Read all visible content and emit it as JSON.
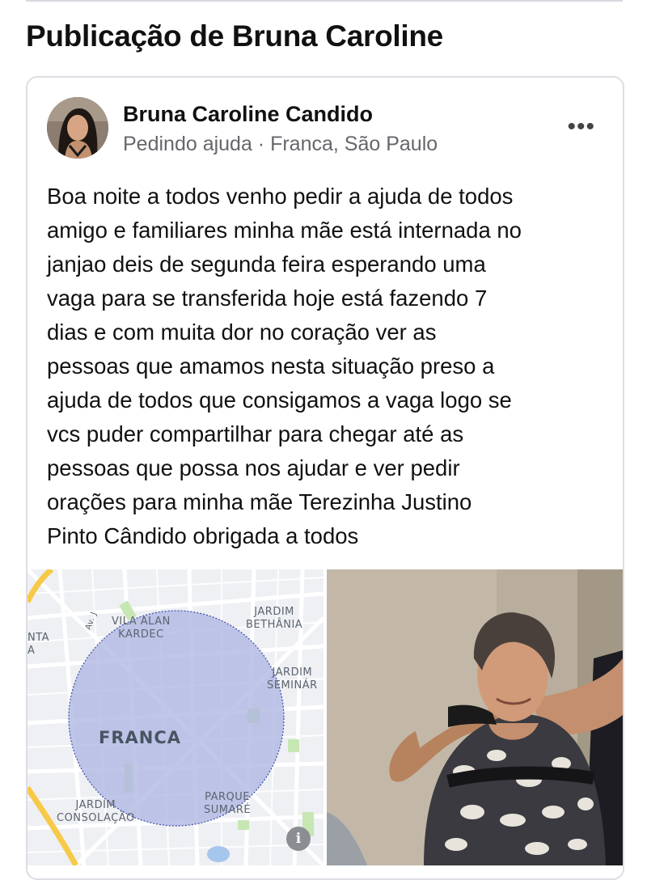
{
  "header": {
    "title": "Publicação de Bruna Caroline"
  },
  "post": {
    "author": "Bruna Caroline Candido",
    "meta": "Pedindo ajuda · Franca, São Paulo",
    "more_icon": "more-horizontal-icon",
    "text": "Boa noite a todos venho pedir a ajuda de todos\namigo e familiares minha mãe está internada no\njanjao  deis de segunda feira esperando uma\nvaga para se transferida hoje está fazendo 7\ndias e com muita dor no coração ver as\npessoas que amamos nesta situação preso a\najuda de todos que consigamos a vaga logo se\nvcs puder compartilhar para chegar até as\npessoas que possa nos ajudar e ver pedir\norações para minha mãe Terezinha Justino\nPinto Cândido obrigada a todos"
  },
  "map": {
    "city": "FRANCA",
    "labels": {
      "vila_alan_kardec": "VILA ALAN\nKARDEC",
      "jardim_bethania": "JARDIM\nBETHÂNIA",
      "jardim_seminar": "JARDIM\nSEMINÁR",
      "parque_sumare": "PARQUE\nSUMARÉ",
      "jardim_consolacao": "JARDIM\nCONSOLAÇÃO",
      "edge_nta": "NTA\nA",
      "av": "Av. J"
    },
    "info_icon": "i",
    "colors": {
      "radius_fill": "#aeb6e2",
      "radius_stroke": "#3c4aa8",
      "road": "#ffffff",
      "main_road": "#f7c948",
      "park": "#c6e6b4"
    }
  }
}
